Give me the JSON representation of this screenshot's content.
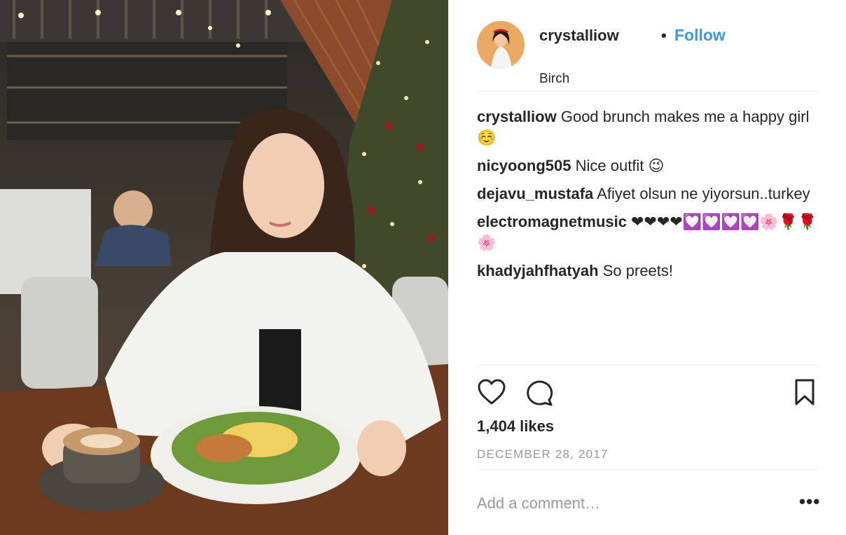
{
  "post": {
    "username": "crystalliow",
    "separator": "•",
    "follow_label": "Follow",
    "location": "Birch"
  },
  "comments": [
    {
      "user": "crystalliow",
      "text": "Good brunch makes me a happy girl ☺️"
    },
    {
      "user": "nicyoong505",
      "text": "Nice outfit 😉"
    },
    {
      "user": "dejavu_mustafa",
      "text": "Afiyet olsun ne yiyorsun..turkey"
    },
    {
      "user": "electromagnetmusic",
      "text": "❤❤❤❤💟💟💟💟🌸🌹🌹🌸"
    },
    {
      "user": "khadyjahfhatyah",
      "text": "So preets!"
    }
  ],
  "actions": {
    "like_icon": "heart-outline-icon",
    "comment_icon": "speech-bubble-icon",
    "save_icon": "bookmark-icon"
  },
  "likes_label": "1,404 likes",
  "date_label": "DECEMBER 28, 2017",
  "add_comment_placeholder": "Add a comment…",
  "more_label": "•••",
  "colors": {
    "link_blue": "#3897f0",
    "text": "#262626",
    "muted": "#999999",
    "divider": "#efefef"
  }
}
